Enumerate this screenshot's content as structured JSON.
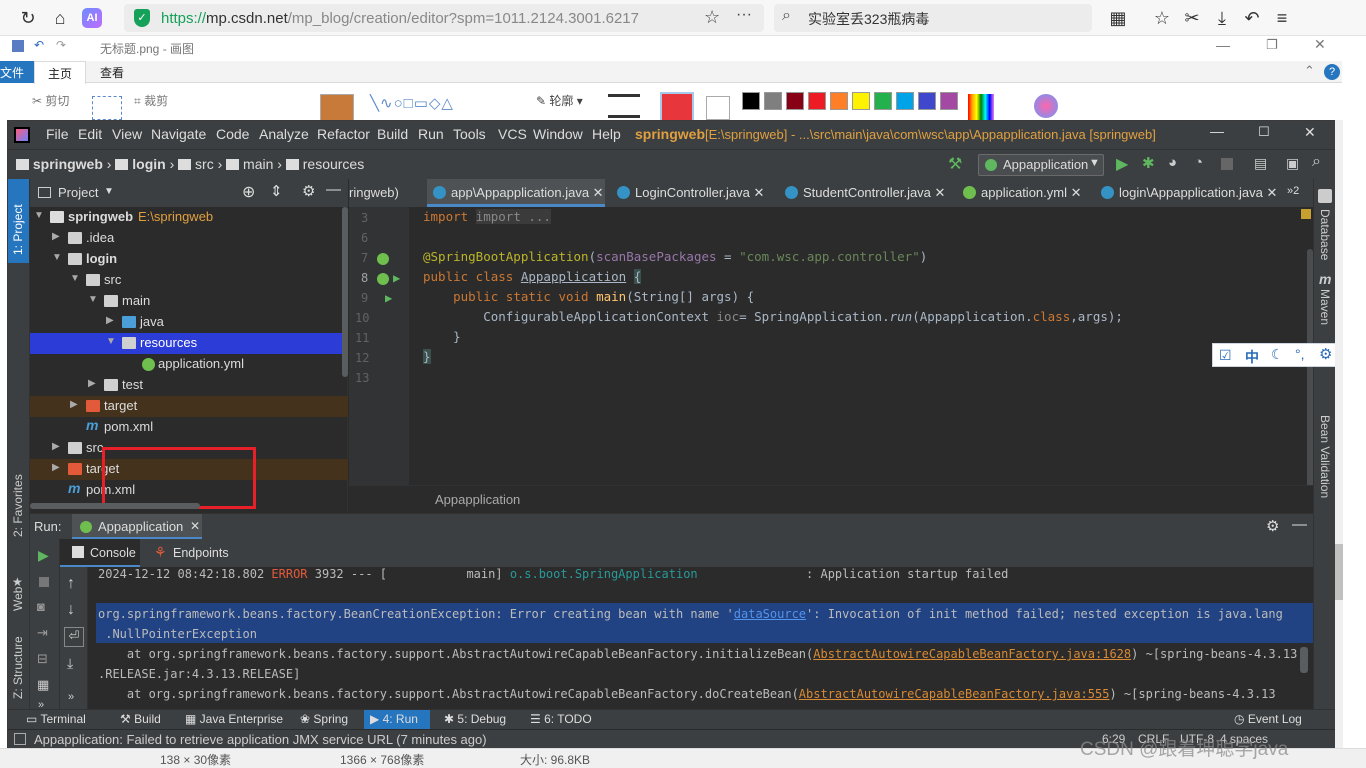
{
  "browser": {
    "url_prefix": "https://",
    "url_host": "mp.csdn.net",
    "url_path": "/mp_blog/creation/editor?spm=1011.2124.3001.6217",
    "search_text": "实验室丢323瓶病毒"
  },
  "paint": {
    "title": "无标题.png - 画图",
    "tabs": [
      "文件",
      "主页",
      "查看"
    ],
    "tools": {
      "cut": "剪切",
      "crop": "裁剪",
      "outline": "轮廓"
    }
  },
  "ide": {
    "menu": [
      "File",
      "Edit",
      "View",
      "Navigate",
      "Code",
      "Analyze",
      "Refactor",
      "Build",
      "Run",
      "Tools",
      "VCS",
      "Window",
      "Help"
    ],
    "title_project": "springweb",
    "title_path": "[E:\\springweb] - ...\\src\\main\\java\\com\\wsc\\app\\Appapplication.java [springweb]",
    "breadcrumb": [
      "springweb",
      "login",
      "src",
      "main",
      "resources"
    ],
    "run_config": "Appapplication",
    "project_panel": {
      "title": "Project",
      "tree": [
        {
          "label": "springweb",
          "extra": "E:\\springweb"
        },
        {
          "label": ".idea"
        },
        {
          "label": "login"
        },
        {
          "label": "src"
        },
        {
          "label": "main"
        },
        {
          "label": "java"
        },
        {
          "label": "resources"
        },
        {
          "label": "application.yml"
        },
        {
          "label": "test"
        },
        {
          "label": "target"
        },
        {
          "label": "pom.xml"
        },
        {
          "label": "src"
        },
        {
          "label": "target"
        },
        {
          "label": "pom.xml"
        }
      ]
    },
    "editor_tabs": [
      "ringweb)",
      "app\\Appapplication.java",
      "LoginController.java",
      "StudentController.java",
      "application.yml",
      "login\\Appapplication.java"
    ],
    "editor_tab_overflow": "2",
    "line_numbers": [
      "3",
      "6",
      "7",
      "8",
      "9",
      "10",
      "11",
      "12",
      "13"
    ],
    "code": {
      "l3": "import ...",
      "l7_annot": "@SpringBootApplication",
      "l7_arg": "scanBasePackages",
      "l7_str": "\"com.wsc.app.controller\"",
      "l8_kw": "public class ",
      "l8_cls": "Appapplication",
      "l9_kw": "public static void ",
      "l9_rest": "main(String[] args) {",
      "l10_a": "ConfigurableApplicationContext ",
      "l10_var": "ioc",
      "l10_b": "= SpringApplication.",
      "l10_run": "run",
      "l10_c": "(Appapplication.",
      "l10_class": "class",
      "l10_d": ",args);"
    },
    "editor_breadcrumb": "Appapplication",
    "run_panel": {
      "label": "Run:",
      "tab": "Appapplication",
      "subtabs": [
        "Console",
        "Endpoints"
      ],
      "lines": {
        "l1_ts": "2024-12-12 08:42:18.802 ",
        "l1_lvl": "ERROR",
        "l1_pid": " 3932 --- [           main] ",
        "l1_cls": "o.s.boot.SpringApplication",
        "l1_msg": "               : Application startup failed",
        "l2_a": "org.springframework.beans.factory.BeanCreationException: Error creating bean with name '",
        "l2_link": "dataSource",
        "l2_b": "': Invocation of init method failed; nested exception is java.lang",
        "l3": " .NullPointerException",
        "l4_a": "    at org.springframework.beans.factory.support.AbstractAutowireCapableBeanFactory.initializeBean(",
        "l4_link": "AbstractAutowireCapableBeanFactory.java:1628",
        "l4_b": ") ~[spring-beans-4.3.13",
        "l5": ".RELEASE.jar:4.3.13.RELEASE]",
        "l6_a": "    at org.springframework.beans.factory.support.AbstractAutowireCapableBeanFactory.doCreateBean(",
        "l6_link": "AbstractAutowireCapableBeanFactory.java:555",
        "l6_b": ") ~[spring-beans-4.3.13"
      }
    },
    "bottom_tools": [
      "Terminal",
      "Build",
      "Java Enterprise",
      "Spring",
      "4: Run",
      "5: Debug",
      "6: TODO",
      "Event Log"
    ],
    "left_tools": [
      "1: Project",
      "2: Favorites",
      "Web",
      "Z: Structure"
    ],
    "right_tools": [
      "Database",
      "Maven",
      "Bean Validation"
    ],
    "status_message": "Appapplication: Failed to retrieve application JMX service URL (7 minutes ago)",
    "status_right": [
      "6:29",
      "CRLF",
      "UTF-8",
      "4 spaces"
    ]
  },
  "paint_status": [
    "138 × 30像素",
    "1366 × 768像素",
    "大小: 96.8KB"
  ],
  "watermark": "CSDN @跟着坤聪学java",
  "ime_bar": [
    "中"
  ],
  "colors": {
    "accent_blue": "#2675bf",
    "selection": "#214283",
    "highlight_red": "#e8373c"
  }
}
